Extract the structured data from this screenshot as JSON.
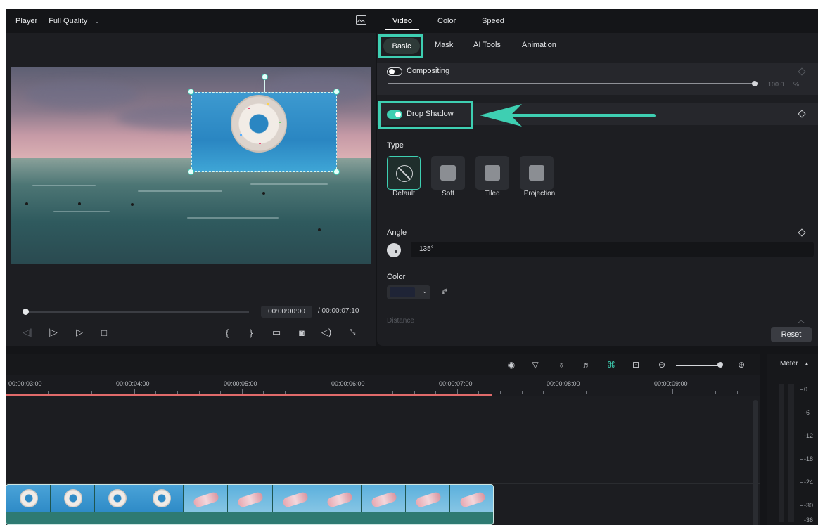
{
  "player": {
    "title": "Player",
    "quality": "Full Quality",
    "current_time": "00:00:00:00",
    "total_time": "/ 00:00:07:10"
  },
  "panel": {
    "tabs": [
      "Video",
      "Color",
      "Speed"
    ],
    "active_tab": "Video",
    "subtabs": [
      "Basic",
      "Mask",
      "AI Tools",
      "Animation"
    ],
    "active_subtab": "Basic",
    "compositing_label": "Compositing",
    "opacity_value": "100.0",
    "opacity_unit": "%",
    "drop_shadow_label": "Drop Shadow",
    "drop_shadow_enabled": true,
    "type_label": "Type",
    "types": [
      "Default",
      "Soft",
      "Tiled",
      "Projection"
    ],
    "selected_type": "Default",
    "angle_label": "Angle",
    "angle_value": "135°",
    "color_label": "Color",
    "color_value": "#1f2436",
    "distance_label": "Distance",
    "reset_label": "Reset"
  },
  "timeline": {
    "ruler_labels": [
      "00:00:03:00",
      "00:00:04:00",
      "00:00:05:00",
      "00:00:06:00",
      "00:00:07:00",
      "00:00:08:00",
      "00:00:09:00"
    ]
  },
  "meter": {
    "label": "Meter",
    "scale": [
      "0",
      "-6",
      "-12",
      "-18",
      "-24",
      "-30",
      "-36"
    ]
  },
  "colors": {
    "accent": "#3ecfb2",
    "playhead_range": "#e06a6a",
    "clip": "#2e7a72"
  }
}
